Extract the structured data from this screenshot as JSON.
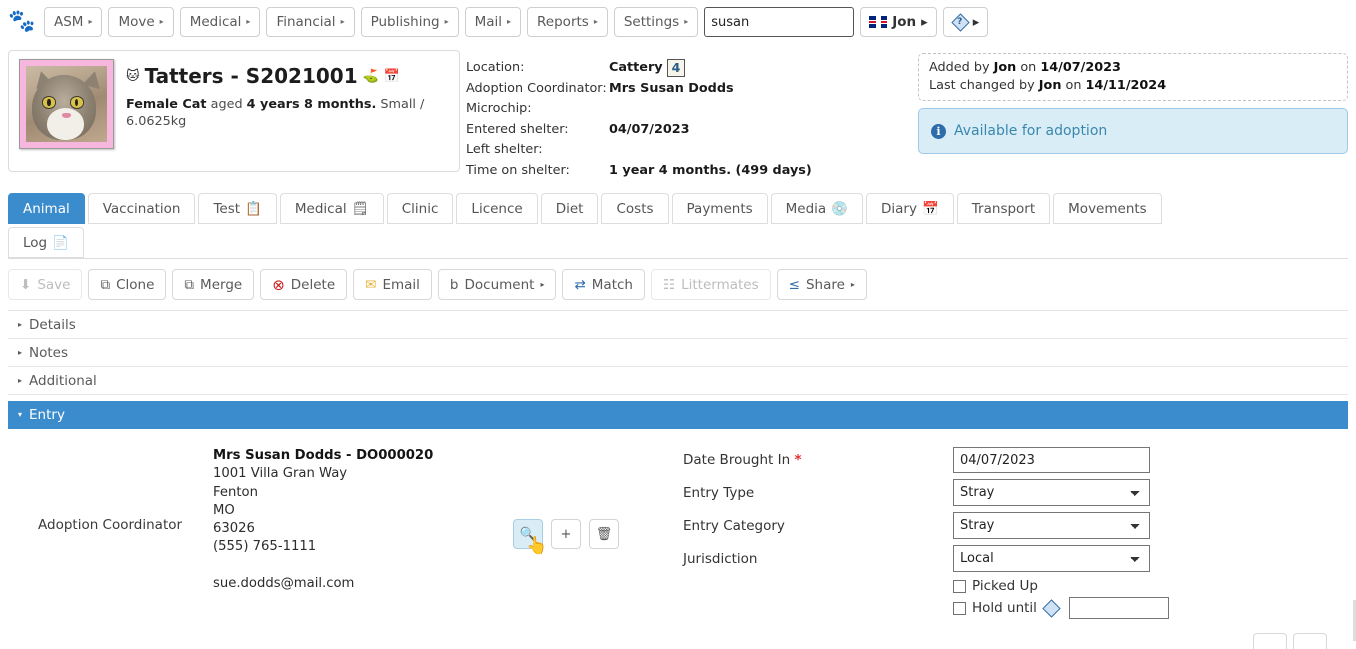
{
  "topnav": {
    "logo_icon": "paw-logo-icon",
    "menus": [
      {
        "label": "ASM",
        "caret": "▸"
      },
      {
        "label": "Move",
        "caret": "▸"
      },
      {
        "label": "Medical",
        "caret": "▸"
      },
      {
        "label": "Financial",
        "caret": "▸"
      },
      {
        "label": "Publishing",
        "caret": "▸"
      },
      {
        "label": "Mail",
        "caret": "▸"
      },
      {
        "label": "Reports",
        "caret": "▸"
      },
      {
        "label": "Settings",
        "caret": "▸"
      }
    ],
    "search": {
      "value": "susan",
      "placeholder": ""
    },
    "user": {
      "name": "Jon",
      "caret": "▸",
      "flag_icon": "uk-flag-icon"
    },
    "help": {
      "caret": "▸",
      "icon": "diamond-help-icon",
      "glyph": "?"
    }
  },
  "animal_header": {
    "photo_alt": "cat-photo",
    "name_and_code": "Tatters - S2021001",
    "title_icons": [
      "animal-thumbnail-icon",
      "person-flag-icon",
      "calendar-icon"
    ],
    "description_prefix": "Female Cat",
    "description_aged": " aged ",
    "description_age": "4 years 8 months.",
    "description_suffix": " Small / 6.0625kg",
    "fields": [
      {
        "label": "Location:",
        "value": "Cattery",
        "badge": "4"
      },
      {
        "label": "Adoption Coordinator:",
        "value": "Mrs Susan Dodds",
        "badge": ""
      },
      {
        "label": "Microchip:",
        "value": "",
        "badge": ""
      },
      {
        "label": "Entered shelter:",
        "value": "04/07/2023",
        "badge": ""
      },
      {
        "label": "Left shelter:",
        "value": "",
        "badge": ""
      },
      {
        "label": "Time on shelter:",
        "value": "1 year 4 months. (499 days)",
        "badge": ""
      }
    ],
    "audit": {
      "added_prefix": "Added by ",
      "added_user": "Jon",
      "added_on": " on ",
      "added_date": "14/07/2023",
      "changed_prefix": "Last changed by ",
      "changed_user": "Jon",
      "changed_on": " on ",
      "changed_date": "14/11/2024"
    },
    "status": {
      "text": "Available for adoption",
      "icon": "info-icon",
      "glyph": "i",
      "color": "#3a87ad",
      "bg": "#d9edf7"
    }
  },
  "tabs": {
    "row1": [
      {
        "label": "Animal",
        "icon": "",
        "active": true
      },
      {
        "label": "Vaccination",
        "icon": "",
        "active": false
      },
      {
        "label": "Test",
        "icon": "📋",
        "active": false
      },
      {
        "label": "Medical",
        "icon": "🗒",
        "active": false
      },
      {
        "label": "Clinic",
        "icon": "",
        "active": false
      },
      {
        "label": "Licence",
        "icon": "",
        "active": false
      },
      {
        "label": "Diet",
        "icon": "",
        "active": false
      },
      {
        "label": "Costs",
        "icon": "",
        "active": false
      },
      {
        "label": "Payments",
        "icon": "",
        "active": false
      },
      {
        "label": "Media",
        "icon": "💿",
        "active": false
      },
      {
        "label": "Diary",
        "icon": "📅",
        "active": false
      },
      {
        "label": "Transport",
        "icon": "",
        "active": false
      },
      {
        "label": "Movements",
        "icon": "",
        "active": false
      }
    ],
    "row2": [
      {
        "label": "Log",
        "icon": "📄",
        "active": false
      }
    ]
  },
  "toolbar": [
    {
      "label": "Save",
      "icon": "save-download-icon",
      "glyph": "⬇",
      "disabled": true,
      "caret": ""
    },
    {
      "label": "Clone",
      "icon": "clone-icon",
      "glyph": "⧉",
      "disabled": false,
      "caret": ""
    },
    {
      "label": "Merge",
      "icon": "merge-icon",
      "glyph": "⧉",
      "disabled": false,
      "caret": ""
    },
    {
      "label": "Delete",
      "icon": "delete-icon",
      "glyph": "⊗",
      "disabled": false,
      "caret": ""
    },
    {
      "label": "Email",
      "icon": "email-icon",
      "glyph": "✉",
      "disabled": false,
      "caret": ""
    },
    {
      "label": "Document",
      "icon": "document-icon",
      "glyph": "὜b",
      "disabled": false,
      "caret": "▸"
    },
    {
      "label": "Match",
      "icon": "match-icon",
      "glyph": "⇄",
      "disabled": false,
      "caret": ""
    },
    {
      "label": "Littermates",
      "icon": "littermates-icon",
      "glyph": "☷",
      "disabled": true,
      "caret": ""
    },
    {
      "label": "Share",
      "icon": "share-icon",
      "glyph": "≤",
      "disabled": false,
      "caret": "▸"
    }
  ],
  "accordion": [
    {
      "label": "Details",
      "open": false,
      "arrow": "▸"
    },
    {
      "label": "Notes",
      "open": false,
      "arrow": "▸"
    },
    {
      "label": "Additional",
      "open": false,
      "arrow": "▸"
    },
    {
      "label": "Entry",
      "open": true,
      "arrow": "▾"
    }
  ],
  "entry": {
    "coordinator_label": "Adoption Coordinator",
    "address": {
      "name": "Mrs Susan Dodds - DO000020",
      "line1": "1001 Villa Gran Way",
      "city": "Fenton",
      "state": "MO",
      "zip": "63026",
      "phone": "(555) 765-1111",
      "email": "sue.dodds@mail.com"
    },
    "record_buttons": [
      {
        "name": "find-person-button",
        "glyph": "🔍",
        "hover": true
      },
      {
        "name": "add-person-button",
        "glyph": "+",
        "hover": false
      },
      {
        "name": "delete-person-button",
        "glyph": "🗑",
        "hover": false
      }
    ],
    "form": {
      "date_brought_in": {
        "label": "Date Brought In",
        "required": "*",
        "value": "04/07/2023"
      },
      "entry_type": {
        "label": "Entry Type",
        "value": "Stray",
        "options": [
          "Stray"
        ]
      },
      "entry_category": {
        "label": "Entry Category",
        "value": "Stray",
        "options": [
          "Stray"
        ]
      },
      "jurisdiction": {
        "label": "Jurisdiction",
        "value": "Local",
        "options": [
          "Local"
        ]
      },
      "picked_up": {
        "label": "Picked Up",
        "checked": false
      },
      "hold_until": {
        "label": "Hold until",
        "checked": false,
        "value": "",
        "icon": "diamond-help-icon"
      }
    }
  },
  "colors": {
    "accent": "#3b8ccd",
    "info_bg": "#d9edf7",
    "info_text": "#3a87ad",
    "photo_frame": "#f7b6dd",
    "required": "#e03030"
  }
}
